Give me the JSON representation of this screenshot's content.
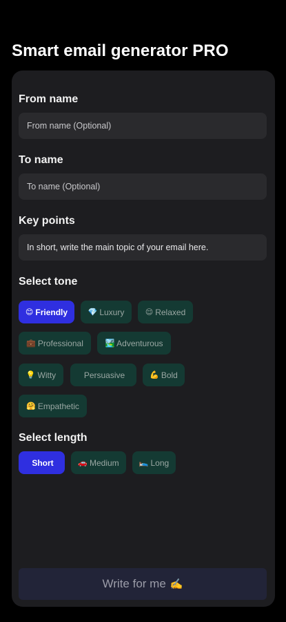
{
  "page_title": "Smart email generator PRO",
  "form": {
    "from_name": {
      "label": "From name",
      "placeholder": "From name (Optional)",
      "value": ""
    },
    "to_name": {
      "label": "To name",
      "placeholder": "To name (Optional)",
      "value": ""
    },
    "key_points": {
      "label": "Key points",
      "placeholder": "In short, write the main topic of your email here.",
      "value": ""
    },
    "tone": {
      "label": "Select tone",
      "selected": "Friendly",
      "options": [
        {
          "emoji": "😊",
          "label": "Friendly"
        },
        {
          "emoji": "💎",
          "label": "Luxury"
        },
        {
          "emoji": "😌",
          "label": "Relaxed"
        },
        {
          "emoji": "💼",
          "label": "Professional"
        },
        {
          "emoji": "🏞️",
          "label": "Adventurous"
        },
        {
          "emoji": "💡",
          "label": "Witty"
        },
        {
          "emoji": "",
          "label": "Persuasive"
        },
        {
          "emoji": "💪",
          "label": "Bold"
        },
        {
          "emoji": "🤗",
          "label": "Empathetic"
        }
      ]
    },
    "length": {
      "label": "Select length",
      "selected": "Short",
      "options": [
        {
          "emoji": "",
          "label": "Short"
        },
        {
          "emoji": "🚗",
          "label": "Medium"
        },
        {
          "emoji": "🛌",
          "label": "Long"
        }
      ]
    },
    "submit": {
      "label": "Write for me",
      "emoji": "✍️"
    }
  },
  "colors": {
    "background": "#000000",
    "card": "#1d1d20",
    "field": "#2a2a2d",
    "chip": "#143a33",
    "chip_selected": "#2f2fe0",
    "submit": "#222438"
  }
}
